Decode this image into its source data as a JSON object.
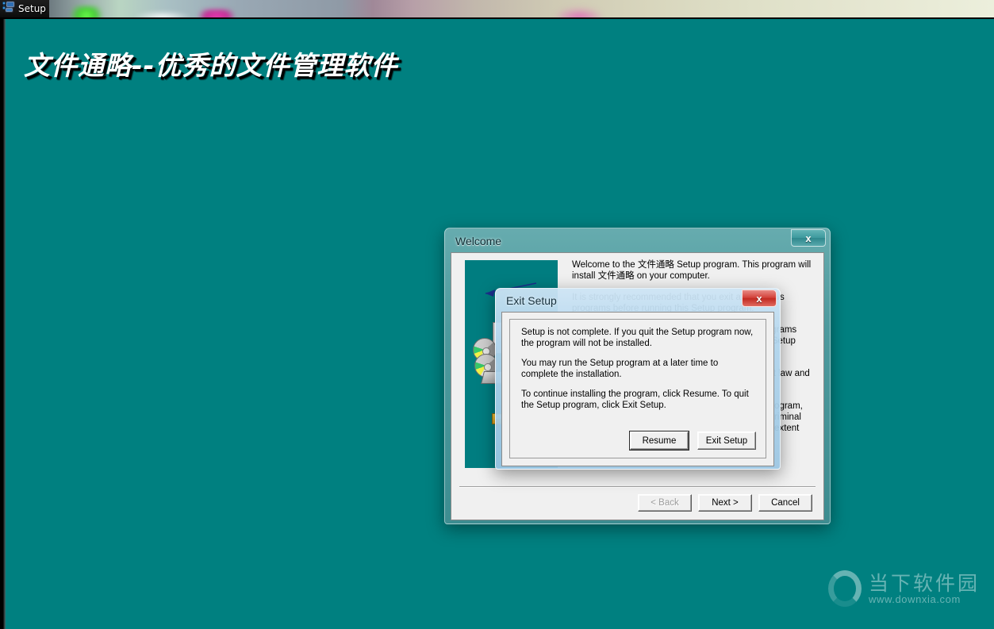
{
  "taskbar": {
    "icon": "computer-network-icon",
    "label": "Setup"
  },
  "background": {
    "title": "文件通略--优秀的文件管理软件",
    "color": "#008080"
  },
  "watermark": {
    "logo": "letter-o-logo",
    "brand": "当下软件园",
    "url": "www.downxia.com"
  },
  "welcome_dialog": {
    "title": "Welcome",
    "close_label": "x",
    "close_icon": "close-icon",
    "image_alt": "setup-illustration",
    "paragraphs": [
      "Welcome to the 文件通略 Setup program.  This program will install 文件通略 on your computer.",
      "It is strongly recommended that you exit all Windows programs before running this Setup program.",
      "Click Cancel to quit Setup and then close any programs you have running.  Click Next to continue with the Setup program.",
      "WARNING: This program is protected by copyright law and international treaties.",
      "Unauthorized reproduction or distribution of this program, or any portion of it, may result in severe civil and criminal penalties, and will be prosecuted to the maximum extent possible under law."
    ],
    "buttons": {
      "back": "< Back",
      "next": "Next >",
      "cancel": "Cancel"
    }
  },
  "exit_dialog": {
    "title": "Exit Setup",
    "close_label": "x",
    "close_icon": "close-icon",
    "paragraphs": [
      "Setup is not complete.  If you quit the Setup program now, the program will not be installed.",
      "You may run the Setup program at a later time to complete the installation.",
      "To continue installing the program, click Resume.  To quit the Setup program, click Exit Setup."
    ],
    "buttons": {
      "resume": "Resume",
      "exit": "Exit Setup"
    }
  }
}
